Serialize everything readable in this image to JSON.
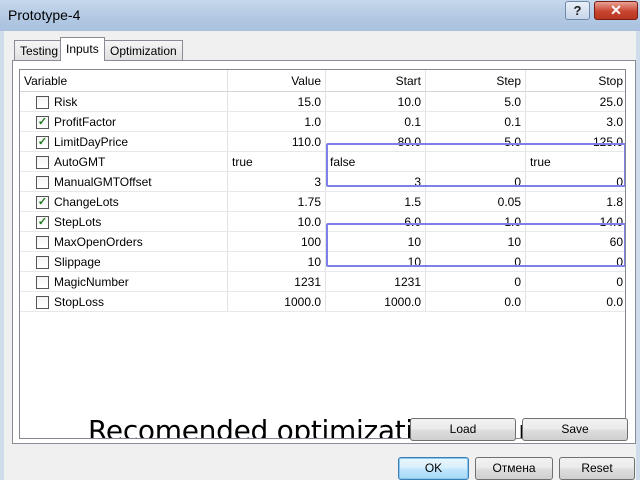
{
  "window": {
    "title": "Prototype-4",
    "help_label": "?",
    "close_label": "✕"
  },
  "tabs": [
    {
      "label": "Testing",
      "active": false
    },
    {
      "label": "Inputs",
      "active": true
    },
    {
      "label": "Optimization",
      "active": false
    }
  ],
  "table": {
    "headers": {
      "variable": "Variable",
      "value": "Value",
      "start": "Start",
      "step": "Step",
      "stop": "Stop"
    },
    "rows": [
      {
        "checked": false,
        "name": "Risk",
        "value": "15.0",
        "start": "10.0",
        "step": "5.0",
        "stop": "25.0"
      },
      {
        "checked": true,
        "name": "ProfitFactor",
        "value": "1.0",
        "start": "0.1",
        "step": "0.1",
        "stop": "3.0"
      },
      {
        "checked": true,
        "name": "LimitDayPrice",
        "value": "110.0",
        "start": "80.0",
        "step": "5.0",
        "stop": "125.0"
      },
      {
        "checked": false,
        "name": "AutoGMT",
        "value": "true",
        "start": "false",
        "step": "",
        "stop": "true"
      },
      {
        "checked": false,
        "name": "ManualGMTOffset",
        "value": "3",
        "start": "3",
        "step": "0",
        "stop": "0"
      },
      {
        "checked": true,
        "name": "ChangeLots",
        "value": "1.75",
        "start": "1.5",
        "step": "0.05",
        "stop": "1.8"
      },
      {
        "checked": true,
        "name": "StepLots",
        "value": "10.0",
        "start": "6.0",
        "step": "1.0",
        "stop": "14.0"
      },
      {
        "checked": false,
        "name": "MaxOpenOrders",
        "value": "100",
        "start": "10",
        "step": "10",
        "stop": "60"
      },
      {
        "checked": false,
        "name": "Slippage",
        "value": "10",
        "start": "10",
        "step": "0",
        "stop": "0"
      },
      {
        "checked": false,
        "name": "MagicNumber",
        "value": "1231",
        "start": "1231",
        "step": "0",
        "stop": "0"
      },
      {
        "checked": false,
        "name": "StopLoss",
        "value": "1000.0",
        "start": "1000.0",
        "step": "0.0",
        "stop": "0.0"
      }
    ]
  },
  "overlay_caption": "Recomended optimization parameters",
  "highlight_color": "#7f7fe8",
  "buttons": {
    "load": "Load",
    "save": "Save",
    "ok": "OK",
    "cancel": "Отмена",
    "reset": "Reset"
  }
}
